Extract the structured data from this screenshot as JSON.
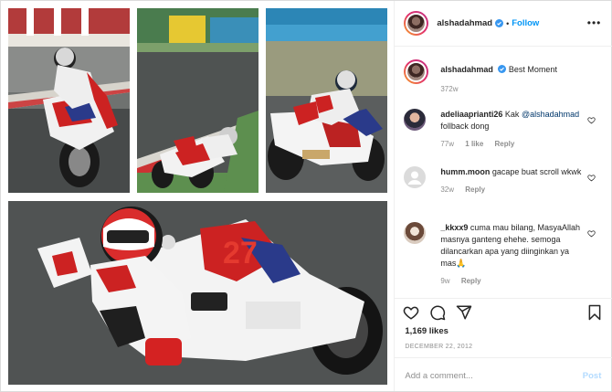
{
  "header": {
    "username": "alshadahmad",
    "separator": "•",
    "follow_label": "Follow",
    "more_label": "•••"
  },
  "caption": {
    "username": "alshadahmad",
    "text": "Best Moment",
    "age": "372w"
  },
  "comments": [
    {
      "username": "adeliaaprianti26",
      "text_before": "Kak",
      "mention": "@alshadahmad",
      "text_after": "follback dong",
      "age": "77w",
      "likes": "1 like",
      "reply": "Reply"
    },
    {
      "username": "humm.moon",
      "text": "gacape buat scroll wkwk",
      "age": "32w",
      "reply": "Reply"
    },
    {
      "username": "_kkxx9",
      "text": "cuma mau bilang, MasyaAllah masnya ganteng ehehe. semoga dilancarkan apa yang diinginkan ya mas🙏",
      "age": "9w",
      "reply": "Reply"
    }
  ],
  "likes": "1,169 likes",
  "date": "DECEMBER 22, 2012",
  "add_comment": {
    "placeholder": "Add a comment...",
    "post_label": "Post"
  },
  "colors": {
    "link": "#0095f6",
    "mention": "#00376b",
    "muted": "#8e8e8e",
    "post_disabled": "#b3dbff"
  },
  "icons": [
    "heart-icon",
    "comment-icon",
    "share-icon",
    "bookmark-icon",
    "verified-icon",
    "more-icon"
  ]
}
